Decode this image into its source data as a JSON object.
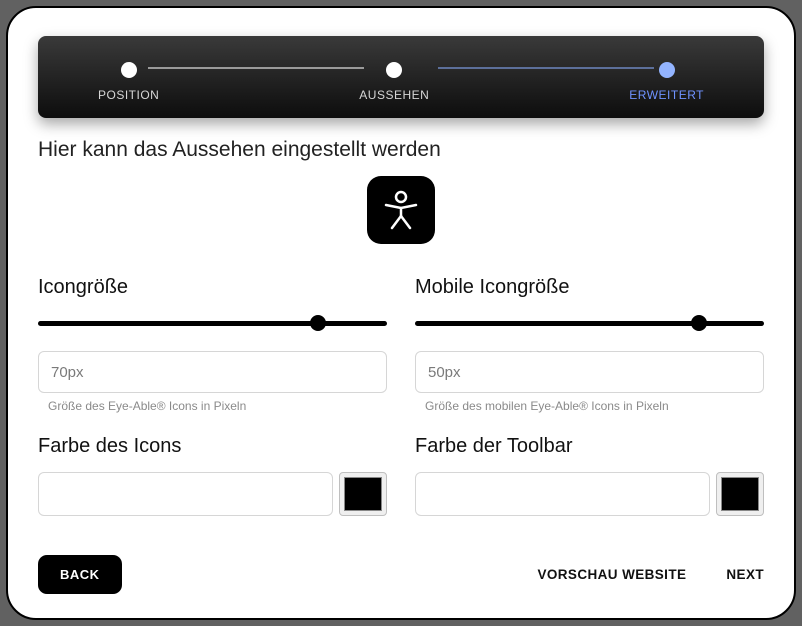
{
  "stepper": {
    "steps": [
      {
        "label": "POSITION",
        "active": false
      },
      {
        "label": "AUSSEHEN",
        "active": false
      },
      {
        "label": "ERWEITERT",
        "active": true
      }
    ]
  },
  "heading": "Hier kann das Aussehen eingestellt werden",
  "iconSize": {
    "label": "Icongröße",
    "value": "70px",
    "helper": "Größe des Eye-Able® Icons in Pixeln",
    "sliderPercent": 78
  },
  "mobileIconSize": {
    "label": "Mobile Icongröße",
    "value": "50px",
    "helper": "Größe des mobilen Eye-Able® Icons in Pixeln",
    "sliderPercent": 79
  },
  "iconColor": {
    "label": "Farbe des Icons",
    "value": "",
    "swatch": "#000000"
  },
  "toolbarColor": {
    "label": "Farbe der Toolbar",
    "value": "",
    "swatch": "#000000"
  },
  "footer": {
    "back": "BACK",
    "preview": "VORSCHAU WEBSITE",
    "next": "NEXT"
  }
}
